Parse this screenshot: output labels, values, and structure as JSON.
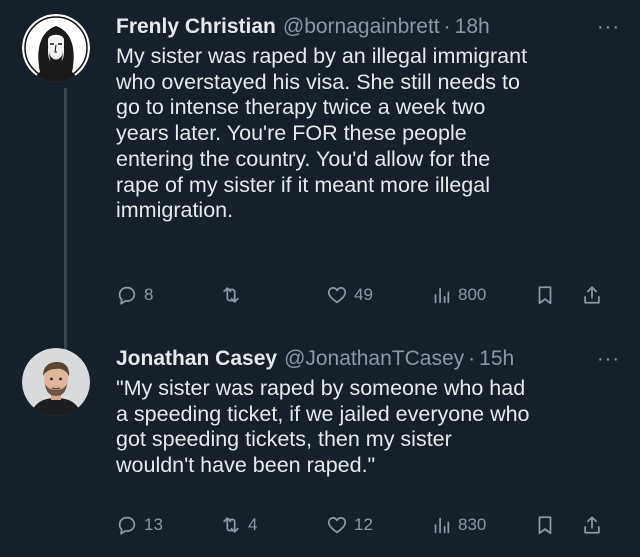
{
  "colors": {
    "background": "#15202b",
    "text_primary": "#e7e9ea",
    "text_secondary": "#8b98a5",
    "thread_line": "#38444d"
  },
  "tweets": [
    {
      "display_name": "Frenly Christian",
      "handle": "@bornagainbrett",
      "separator": "·",
      "time": "18h",
      "more": "···",
      "avatar_icon": "jesus-portrait-icon",
      "text": "My sister was raped by an illegal immigrant\nwho overstayed his visa. She still needs to\ngo to intense therapy twice a week two\nyears later. You're FOR these people\nentering the country. You'd allow for the\nrape of my sister if it meant more illegal\nimmigration.",
      "actions": {
        "replies": "8",
        "reposts": "",
        "likes": "49",
        "views": "800"
      }
    },
    {
      "display_name": "Jonathan Casey",
      "handle": "@JonathanTCasey",
      "separator": "·",
      "time": "15h",
      "more": "···",
      "avatar_icon": "profile-photo-icon",
      "text": "\"My sister was raped by someone who had\na speeding ticket, if we jailed everyone who\ngot speeding tickets, then my sister\nwouldn't have been raped.\"",
      "actions": {
        "replies": "13",
        "reposts": "4",
        "likes": "12",
        "views": "830"
      }
    }
  ]
}
